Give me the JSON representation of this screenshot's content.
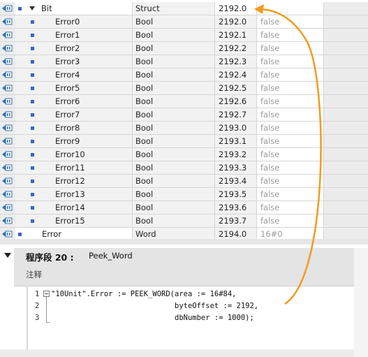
{
  "colors": {
    "accent_arrow": "#f39a1d",
    "member_marker": "#3a62c9"
  },
  "rows": [
    {
      "name": "Bit",
      "type": "Struct",
      "offset": "2192.0",
      "start": "",
      "level": 0,
      "kind": "struct"
    },
    {
      "name": "Error0",
      "type": "Bool",
      "offset": "2192.0",
      "start": "false",
      "level": 1
    },
    {
      "name": "Error1",
      "type": "Bool",
      "offset": "2192.1",
      "start": "false",
      "level": 1
    },
    {
      "name": "Error2",
      "type": "Bool",
      "offset": "2192.2",
      "start": "false",
      "level": 1
    },
    {
      "name": "Error3",
      "type": "Bool",
      "offset": "2192.3",
      "start": "false",
      "level": 1
    },
    {
      "name": "Error4",
      "type": "Bool",
      "offset": "2192.4",
      "start": "false",
      "level": 1
    },
    {
      "name": "Error5",
      "type": "Bool",
      "offset": "2192.5",
      "start": "false",
      "level": 1
    },
    {
      "name": "Error6",
      "type": "Bool",
      "offset": "2192.6",
      "start": "false",
      "level": 1
    },
    {
      "name": "Error7",
      "type": "Bool",
      "offset": "2192.7",
      "start": "false",
      "level": 1
    },
    {
      "name": "Error8",
      "type": "Bool",
      "offset": "2193.0",
      "start": "false",
      "level": 1
    },
    {
      "name": "Error9",
      "type": "Bool",
      "offset": "2193.1",
      "start": "false",
      "level": 1
    },
    {
      "name": "Error10",
      "type": "Bool",
      "offset": "2193.2",
      "start": "false",
      "level": 1
    },
    {
      "name": "Error11",
      "type": "Bool",
      "offset": "2193.3",
      "start": "false",
      "level": 1
    },
    {
      "name": "Error12",
      "type": "Bool",
      "offset": "2193.4",
      "start": "false",
      "level": 1
    },
    {
      "name": "Error13",
      "type": "Bool",
      "offset": "2193.5",
      "start": "false",
      "level": 1
    },
    {
      "name": "Error14",
      "type": "Bool",
      "offset": "2193.6",
      "start": "false",
      "level": 1
    },
    {
      "name": "Error15",
      "type": "Bool",
      "offset": "2193.7",
      "start": "false",
      "level": 1
    },
    {
      "name": "Error",
      "type": "Word",
      "offset": "2194.0",
      "start": "16#0",
      "level": 0,
      "kind": "word"
    }
  ],
  "network": {
    "title": "程序段 20 :",
    "name": "Peek_Word",
    "comment": "注释",
    "code_lines": [
      {
        "num": "1",
        "text": "\"10Unit\".Error := PEEK_WORD(area := 16#84,"
      },
      {
        "num": "2",
        "text": "                            byteOffset := 2192,"
      },
      {
        "num": "3",
        "text": "                            dbNumber := 1000);"
      }
    ]
  }
}
